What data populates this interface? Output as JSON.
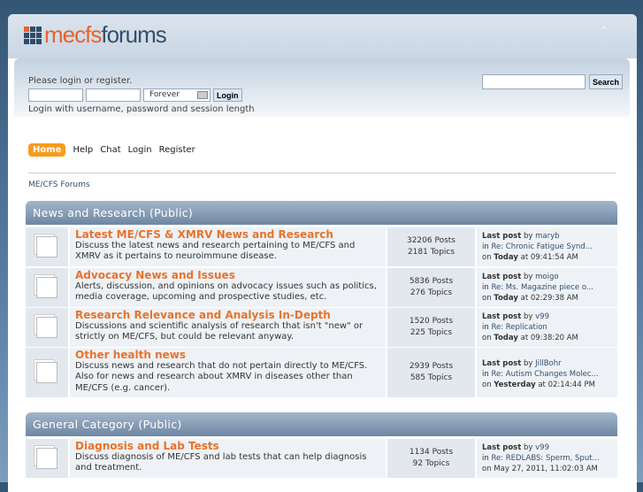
{
  "logo": {
    "part1": "mecfs",
    "part2": "forums"
  },
  "login": {
    "message": "Please login or register.",
    "session": "Forever",
    "button": "Login",
    "hint": "Login with username, password and session length"
  },
  "search": {
    "button": "Search"
  },
  "menu": [
    "Home",
    "Help",
    "Chat",
    "Login",
    "Register"
  ],
  "breadcrumb": "ME/CFS Forums",
  "categories": [
    {
      "title": "News and Research (Public)",
      "boards": [
        {
          "name": "Latest ME/CFS & XMRV News and Research",
          "desc": "Discuss the latest news and research pertaining to ME/CFS and XMRV as it pertains to neuroimmune disease.",
          "posts": "32206 Posts",
          "topics": "2181 Topics",
          "by": "maryb",
          "in": "Re: Chronic Fatigue Synd...",
          "day": "Today",
          "time": "at 09:41:54 AM"
        },
        {
          "name": "Advocacy News and Issues",
          "desc": "Alerts, discussion, and opinions on advocacy issues such as politics, media coverage, upcoming and prospective studies, etc.",
          "posts": "5836 Posts",
          "topics": "276 Topics",
          "by": "moigo",
          "in": "Re: Ms. Magazine piece o...",
          "day": "Today",
          "time": "at 02:29:38 AM"
        },
        {
          "name": "Research Relevance and Analysis In-Depth",
          "desc": "Discussions and scientific analysis of research that isn't \"new\" or strictly on ME/CFS, but could be relevant anyway.",
          "posts": "1520 Posts",
          "topics": "225 Topics",
          "by": "v99",
          "in": "Re: Replication",
          "day": "Today",
          "time": "at 09:38:20 AM"
        },
        {
          "name": "Other health news",
          "desc": "Discuss news and research that do not pertain directly to ME/CFS. Also for news and research about XMRV in diseases other than ME/CFS (e.g. cancer).",
          "posts": "2939 Posts",
          "topics": "585 Topics",
          "by": "JillBohr",
          "in": "Re: Autism Changes Molec...",
          "day": "Yesterday",
          "time": "at 02:14:44 PM"
        }
      ]
    },
    {
      "title": "General Category (Public)",
      "boards": [
        {
          "name": "Diagnosis and Lab Tests",
          "desc": "Discuss diagnosis of ME/CFS and lab tests that can help diagnosis and treatment.",
          "posts": "1134 Posts",
          "topics": "92 Topics",
          "by": "v99",
          "in": "Re: REDLABS: Sperm, Sput...",
          "day": "",
          "time": "May 27, 2011, 11:02:03 AM"
        }
      ]
    }
  ],
  "labels": {
    "last_post": "Last post",
    "by": "by",
    "in": "in",
    "on": "on"
  }
}
